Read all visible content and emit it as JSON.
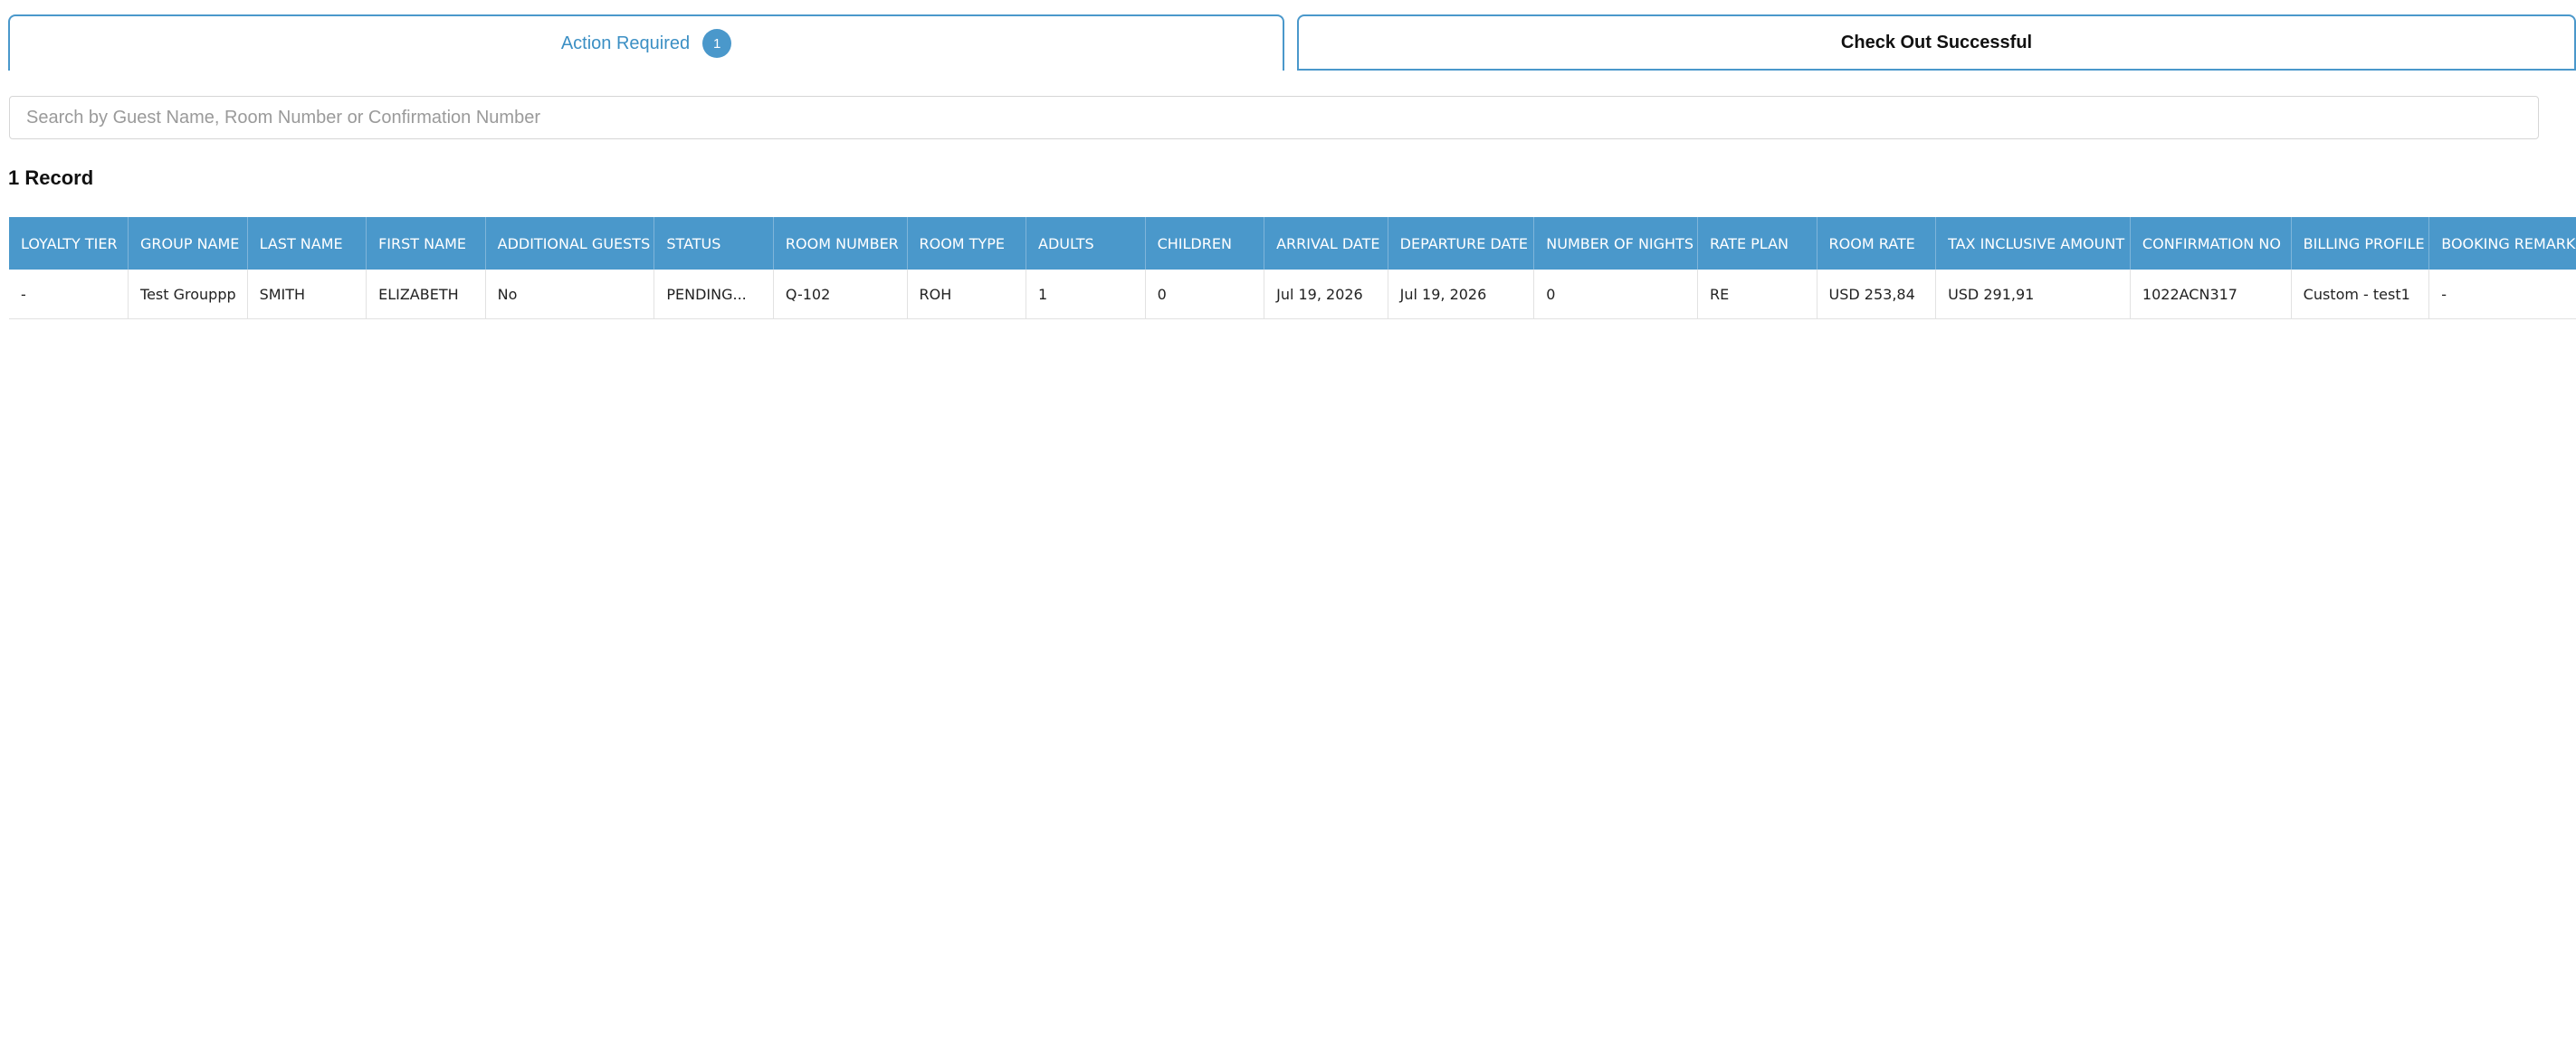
{
  "tabs": {
    "action_required": {
      "label": "Action Required",
      "badge": "1"
    },
    "check_out_successful": {
      "label": "Check Out Successful"
    }
  },
  "search": {
    "placeholder": "Search by Guest Name, Room Number or Confirmation Number",
    "value": ""
  },
  "record_count": "1 Record",
  "colors": {
    "accent": "#4a98cb"
  },
  "table": {
    "columns": [
      "LOYALTY TIER",
      "GROUP NAME",
      "LAST NAME",
      "FIRST NAME",
      "ADDITIONAL GUESTS",
      "STATUS",
      "ROOM NUMBER",
      "ROOM TYPE",
      "ADULTS",
      "CHILDREN",
      "ARRIVAL DATE",
      "DEPARTURE DATE",
      "NUMBER OF NIGHTS",
      "RATE PLAN",
      "ROOM RATE",
      "TAX INCLUSIVE AMOUNT",
      "CONFIRMATION NO",
      "BILLING PROFILE",
      "BOOKING REMARKS"
    ],
    "rows": [
      [
        "-",
        "Test Grouppp",
        "SMITH",
        "ELIZABETH",
        "No",
        "PENDING...",
        "Q-102",
        "ROH",
        "1",
        "0",
        "Jul 19, 2026",
        "Jul 19, 2026",
        "0",
        "RE",
        "USD 253,84",
        "USD 291,91",
        "1022ACN317",
        "Custom - test1",
        "-"
      ]
    ]
  }
}
